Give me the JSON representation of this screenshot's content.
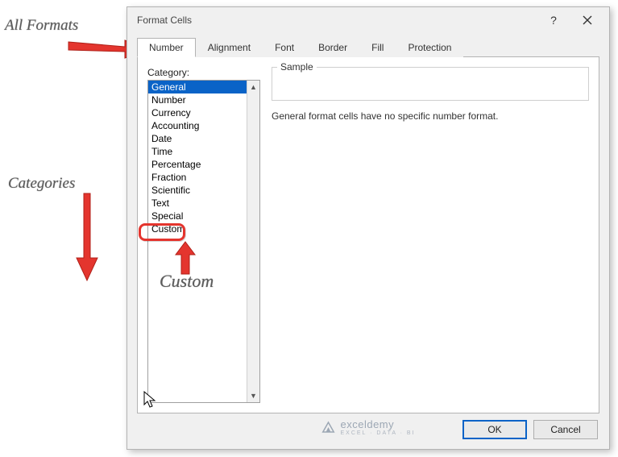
{
  "annotations": {
    "all_formats": "All Formats",
    "categories": "Categories",
    "custom": "Custom"
  },
  "dialog": {
    "title": "Format Cells",
    "help_tooltip": "?",
    "tabs": [
      "Number",
      "Alignment",
      "Font",
      "Border",
      "Fill",
      "Protection"
    ],
    "active_tab_index": 0,
    "category_label": "Category:",
    "categories": [
      "General",
      "Number",
      "Currency",
      "Accounting",
      "Date",
      "Time",
      "Percentage",
      "Fraction",
      "Scientific",
      "Text",
      "Special",
      "Custom"
    ],
    "selected_category_index": 0,
    "highlighted_category_index": 11,
    "sample_label": "Sample",
    "description": "General format cells have no specific number format.",
    "ok_label": "OK",
    "cancel_label": "Cancel"
  },
  "watermark": {
    "brand": "exceldemy",
    "tagline": "EXCEL · DATA · BI"
  }
}
